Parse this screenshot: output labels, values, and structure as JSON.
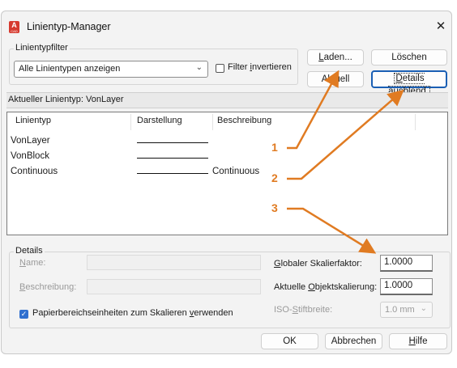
{
  "window": {
    "title": "Linientyp-Manager",
    "app_icon_letter": "A",
    "app_icon_caption": "CAD",
    "close_glyph": "✕"
  },
  "filter": {
    "group_label": "Linientypfilter",
    "selected": "Alle Linientypen anzeigen",
    "invert_checked": false,
    "invert_label_pre": "Filter ",
    "invert_label_u": "i",
    "invert_label_post": "nvertieren"
  },
  "buttons": {
    "load_u": "L",
    "load_rest": "aden...",
    "delete": "Löschen",
    "current": "Aktuell",
    "details_u": "D",
    "details_rest": "etails ausblend.",
    "ok": "OK",
    "cancel": "Abbrechen",
    "help_u": "H",
    "help_rest": "ilfe"
  },
  "current_linetype": {
    "label": "Aktueller Linientyp:",
    "value": "VonLayer"
  },
  "list": {
    "columns": [
      "Linientyp",
      "Darstellung",
      "Beschreibung"
    ],
    "rows": [
      {
        "name": "VonLayer",
        "description": ""
      },
      {
        "name": "VonBlock",
        "description": ""
      },
      {
        "name": "Continuous",
        "description": "Continuous"
      }
    ]
  },
  "details": {
    "group_label": "Details",
    "name_label_u": "N",
    "name_label_rest": "ame:",
    "desc_label_u": "B",
    "desc_label_rest": "eschreibung:",
    "global_scale_label_u": "G",
    "global_scale_label_rest": "lobaler Skalierfaktor:",
    "global_scale_value": "1.0000",
    "object_scale_label_pre": "Aktuelle ",
    "object_scale_label_u": "O",
    "object_scale_label_post": "bjektskalierung:",
    "object_scale_value": "1.0000",
    "iso_label_pre": "ISO-",
    "iso_label_u": "S",
    "iso_label_post": "tiftbreite:",
    "iso_value": "1.0 mm",
    "paper_checked": true,
    "paper_label_pre": "Papierbereichseinheiten zum Skalieren ",
    "paper_label_u": "v",
    "paper_label_post": "erwenden"
  },
  "annotations": {
    "color": "#e07b22",
    "labels": [
      "1",
      "2",
      "3"
    ]
  }
}
